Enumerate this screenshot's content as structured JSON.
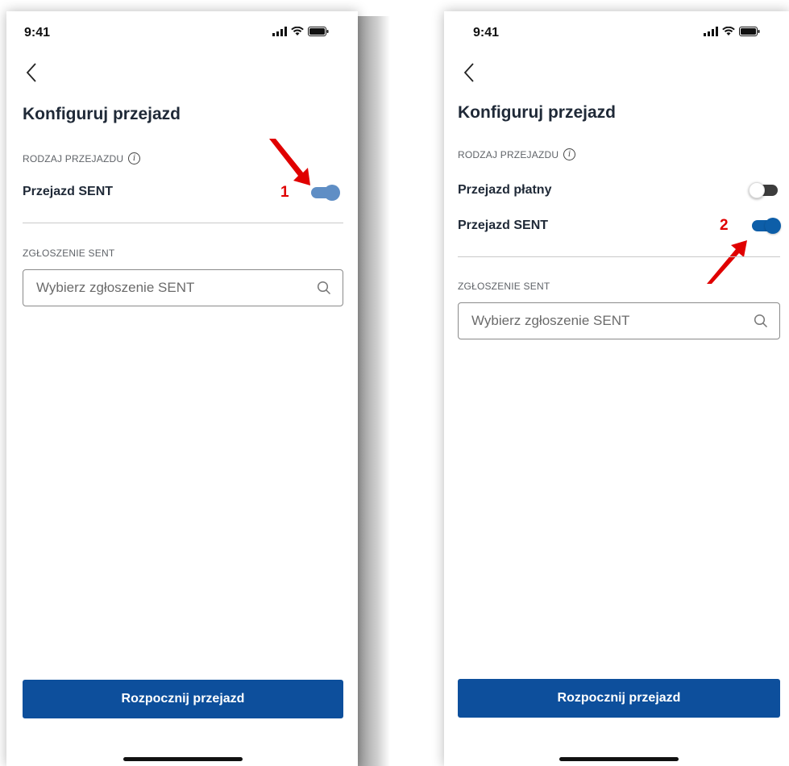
{
  "colors": {
    "primary": "#0d4f9c",
    "toggle_on": "#0d5ea8",
    "annotation": "#e00000"
  },
  "screens": [
    {
      "status": {
        "time": "9:41"
      },
      "title": "Konfiguruj przejazd",
      "ride_type_label": "RODZAJ PRZEJAZDU",
      "options": [
        {
          "label": "Przejazd SENT",
          "enabled": true
        }
      ],
      "sent_section_label": "ZGŁOSZENIE SENT",
      "search_placeholder": "Wybierz zgłoszenie SENT",
      "start_button": "Rozpocznij przejazd",
      "annotation": "1"
    },
    {
      "status": {
        "time": "9:41"
      },
      "title": "Konfiguruj przejazd",
      "ride_type_label": "RODZAJ PRZEJAZDU",
      "options": [
        {
          "label": "Przejazd płatny",
          "enabled": false
        },
        {
          "label": "Przejazd SENT",
          "enabled": true
        }
      ],
      "sent_section_label": "ZGŁOSZENIE SENT",
      "search_placeholder": "Wybierz zgłoszenie SENT",
      "start_button": "Rozpocznij przejazd",
      "annotation": "2"
    }
  ]
}
